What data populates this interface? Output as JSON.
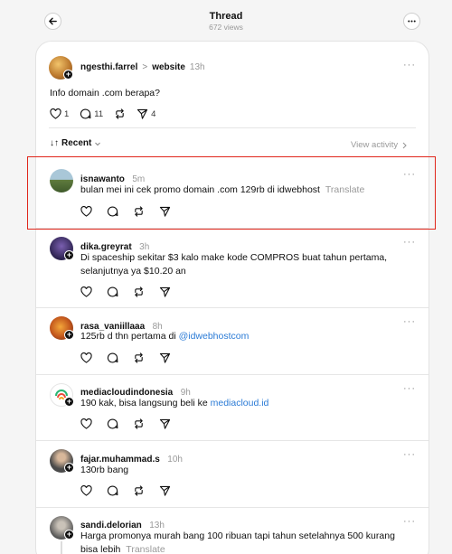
{
  "header": {
    "title": "Thread",
    "views": "672 views"
  },
  "original_post": {
    "username": "ngesthi.farrel",
    "separator": ">",
    "tag": "website",
    "time": "13h",
    "text": "Info domain .com berapa?",
    "likes": "1",
    "replies": "11",
    "shares": "4"
  },
  "sort": {
    "label": "Recent",
    "view_activity": "View activity"
  },
  "replies": [
    {
      "username": "isnawanto",
      "time": "5m",
      "text": "bulan mei ini cek promo domain .com 129rb di idwebhost",
      "translate": "Translate",
      "highlighted": true
    },
    {
      "username": "dika.greyrat",
      "time": "3h",
      "text": "Di spaceship sekitar $3 kalo make kode COMPROS buat tahun pertama, selanjutnya ya $10.20 an"
    },
    {
      "username": "rasa_vaniillaaa",
      "time": "8h",
      "text_prefix": "125rb d thn pertama di ",
      "mention": "@idwebhostcom"
    },
    {
      "username": "mediacloudindonesia",
      "time": "9h",
      "text_prefix": "190 kak, bisa langsung beli ke ",
      "link": "mediacloud.id"
    },
    {
      "username": "fajar.muhammad.s",
      "time": "10h",
      "text": "130rb bang"
    },
    {
      "username": "sandi.delorian",
      "time": "13h",
      "text": "Harga promonya murah bang 100 ribuan tapi tahun setelahnya 500 kurang bisa lebih",
      "translate": "Translate"
    }
  ],
  "colors": {
    "highlight": "#e0261b",
    "link": "#2b7bd6"
  }
}
